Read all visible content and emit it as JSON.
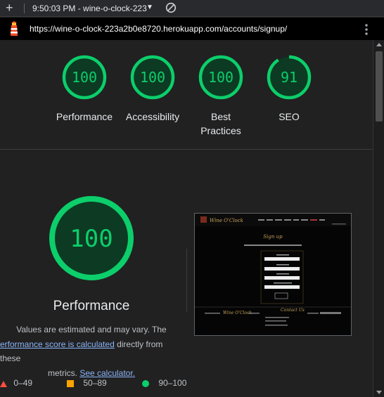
{
  "toolbar": {
    "new_label": "+",
    "page_select": "9:50:03 PM - wine-o-clock-223"
  },
  "url_bar": {
    "url": "https://wine-o-clock-223a2b0e8720.herokuapp.com/accounts/signup/"
  },
  "summary_scores": [
    {
      "score": 100,
      "label": "Performance"
    },
    {
      "score": 100,
      "label": "Accessibility"
    },
    {
      "score": 100,
      "label": "Best Practices"
    },
    {
      "score": 91,
      "label": "SEO"
    }
  ],
  "performance": {
    "score": 100,
    "title": "Performance",
    "desc_line1": "Values are estimated and may vary. The",
    "desc_link": "erformance score is calculated",
    "desc_line2_rest": " directly from these",
    "desc_line3": "metrics.",
    "calc_link": "See calculator."
  },
  "legend": [
    {
      "range": "0–49",
      "color": "#ff4e42",
      "shape": "triangle"
    },
    {
      "range": "50–89",
      "color": "#ffa400",
      "shape": "square"
    },
    {
      "range": "90–100",
      "color": "#0cce6b",
      "shape": "circle"
    }
  ],
  "screenshot": {
    "brand": "Wine O'Clock",
    "heading": "Sign up",
    "contact": "Contact Us",
    "footer_brand": "Wine O'Clock"
  },
  "colors": {
    "pass": "#0cce6b",
    "pass_bg": "#0d3a23",
    "link": "#8ab4f8",
    "brand_gold": "#c8a25a"
  }
}
